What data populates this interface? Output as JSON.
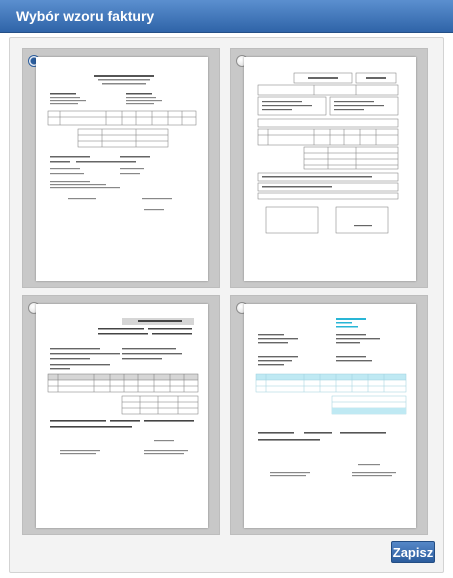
{
  "window": {
    "title": "Wybór wzoru faktury"
  },
  "templates": [
    {
      "id": "template-1",
      "selected": true
    },
    {
      "id": "template-2",
      "selected": false
    },
    {
      "id": "template-3",
      "selected": false
    },
    {
      "id": "template-4",
      "selected": false
    }
  ],
  "actions": {
    "save_label": "Zapisz"
  },
  "colors": {
    "accent": "#2f64a8",
    "panel_bg": "#f3f3f3",
    "card_bg": "#c8c8c8",
    "invoice_highlight": "#29b6d6"
  }
}
